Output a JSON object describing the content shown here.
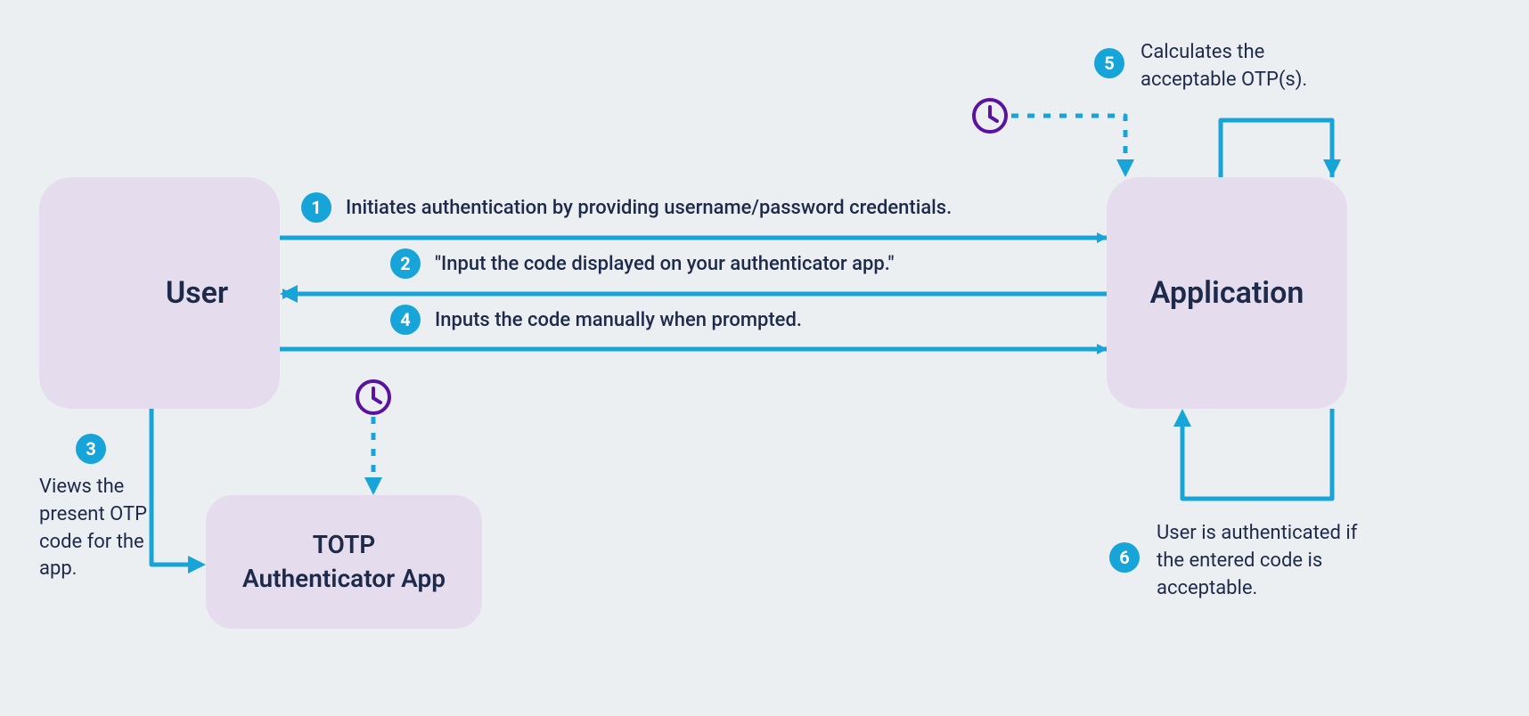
{
  "nodes": {
    "user": "User",
    "application": "Application",
    "totp_line1": "TOTP",
    "totp_line2": "Authenticator App"
  },
  "steps": {
    "s1": {
      "num": "1",
      "text": "Initiates authentication by providing username/password credentials."
    },
    "s2": {
      "num": "2",
      "text": "\"Input the code displayed on your authenticator app.\""
    },
    "s3": {
      "num": "3",
      "text": "Views the present OTP code for the app."
    },
    "s4": {
      "num": "4",
      "text": "Inputs the code manually when prompted."
    },
    "s5": {
      "num": "5",
      "text": "Calculates the acceptable OTP(s)."
    },
    "s6": {
      "num": "6",
      "text": "User is authenticated if the entered code is acceptable."
    }
  },
  "colors": {
    "accent": "#17a4d9",
    "nodeFill": "#e5dcee",
    "purple": "#5a13a0",
    "text": "#1e2a4a",
    "bg": "#eceff1"
  }
}
